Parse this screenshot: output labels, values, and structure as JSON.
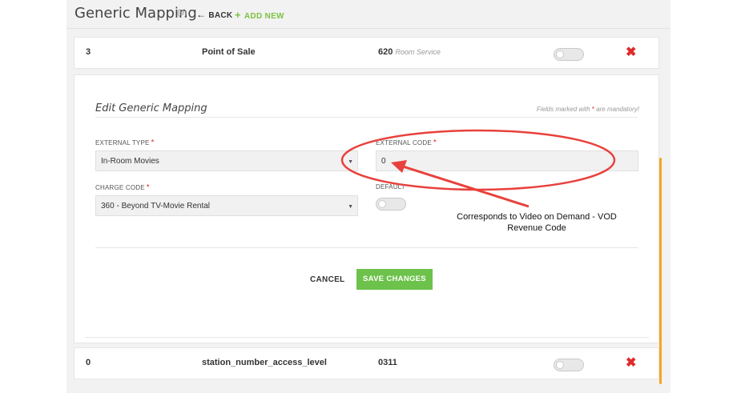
{
  "header": {
    "title": "Generic Mapping",
    "count": "(9)",
    "back_label": "BACK",
    "add_new_label": "ADD NEW"
  },
  "rows": [
    {
      "code": "3",
      "name": "Point of Sale",
      "value": "620",
      "value_note": "Room Service",
      "default_on": false
    },
    {
      "code": "0",
      "name": "station_number_access_level",
      "value": "0311",
      "value_note": "",
      "default_on": false
    }
  ],
  "edit": {
    "title": "Edit Generic Mapping",
    "mandatory_note_prefix": "Fields marked with",
    "mandatory_star": "*",
    "mandatory_note_suffix": "are mandatory!",
    "external_type": {
      "label": "EXTERNAL TYPE",
      "value": "In-Room Movies"
    },
    "external_code": {
      "label": "EXTERNAL CODE",
      "value": "0"
    },
    "charge_code": {
      "label": "CHARGE CODE",
      "value": "360 - Beyond TV-Movie Rental"
    },
    "default": {
      "label": "DEFAULT",
      "on": false
    },
    "cancel_label": "CANCEL",
    "save_label": "SAVE CHANGES"
  },
  "annotation": {
    "text_line1": "Corresponds to Video on Demand - VOD",
    "text_line2": "Revenue Code",
    "color": "#e8413c"
  },
  "colors": {
    "accent_green": "#6cc24a",
    "delete_red": "#e02b2b",
    "scrollbar_orange": "#f5a623"
  },
  "icons": {
    "back": "arrow-left-icon",
    "add": "plus-icon",
    "delete": "close-x-icon",
    "select": "caret-down-icon"
  }
}
